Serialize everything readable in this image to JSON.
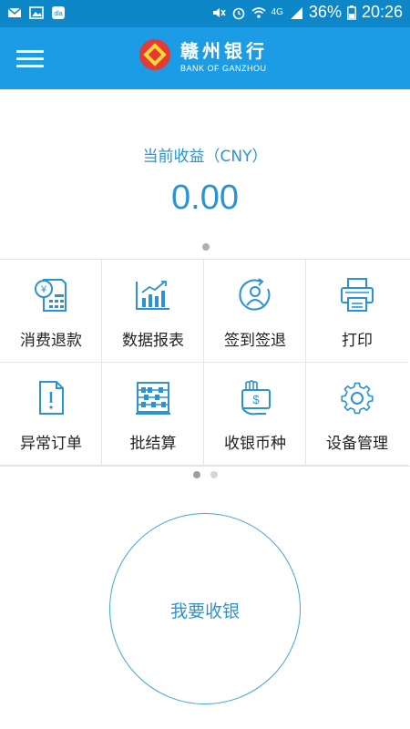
{
  "status_bar": {
    "network": "4G",
    "battery": "36%",
    "time": "20:26"
  },
  "header": {
    "logo_cn": "赣州银行",
    "logo_en": "BANK OF GANZHOU"
  },
  "earnings": {
    "label": "当前收益（CNY）",
    "value": "0.00"
  },
  "menu_grid": [
    {
      "label": "消费退款",
      "icon": "refund-icon"
    },
    {
      "label": "数据报表",
      "icon": "chart-icon"
    },
    {
      "label": "签到签退",
      "icon": "user-checkin-icon"
    },
    {
      "label": "打印",
      "icon": "printer-icon"
    },
    {
      "label": "异常订单",
      "icon": "alert-document-icon"
    },
    {
      "label": "批结算",
      "icon": "abacus-icon"
    },
    {
      "label": "收银币种",
      "icon": "cash-hand-icon"
    },
    {
      "label": "设备管理",
      "icon": "gear-icon"
    }
  ],
  "action": {
    "label": "我要收银"
  },
  "colors": {
    "primary": "#1b9ce4",
    "accent": "#2a93d5"
  }
}
